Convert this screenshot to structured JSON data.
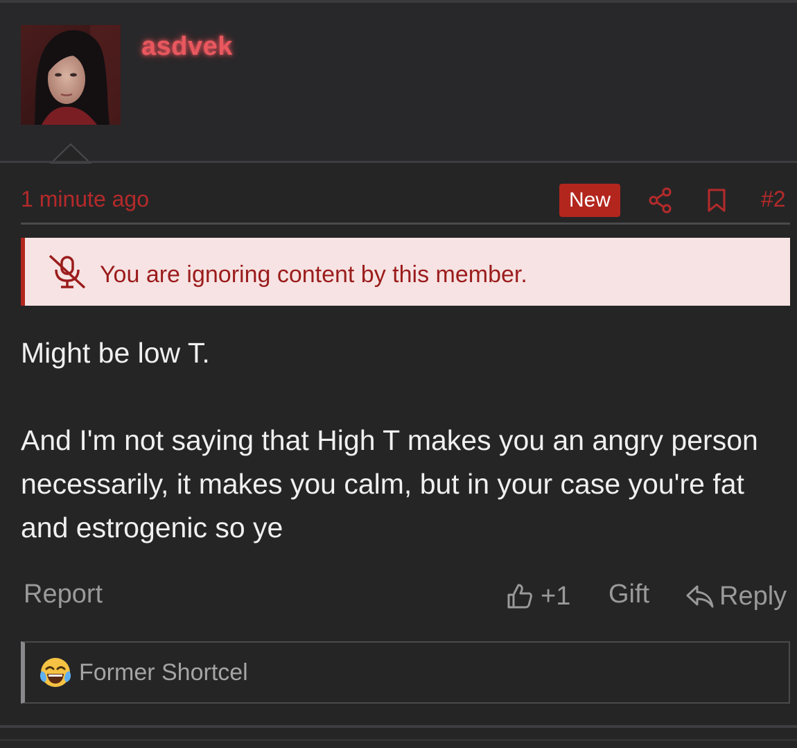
{
  "post": {
    "username": "asdvek",
    "timestamp": "1 minute ago",
    "new_badge": "New",
    "post_number": "#2",
    "icons": {
      "share": "share-icon",
      "bookmark": "bookmark-icon",
      "mute": "mute-microphone-icon",
      "like": "thumbs-up-icon",
      "reply": "reply-arrow-icon",
      "signature_emoji": "crying-laughing-emoji"
    },
    "ignore_notice": "You are ignoring content by this member.",
    "body": {
      "line1": "Might be low T.",
      "para2": "And I'm not saying that High T makes you an angry person necessarily, it makes you calm, but in your case you're fat and estrogenic so ye"
    },
    "actions": {
      "report": "Report",
      "like_count": "+1",
      "gift": "Gift",
      "reply": "Reply"
    },
    "signature": "Former Shortcel"
  },
  "colors": {
    "accent_red": "#b3261e",
    "username_glow": "#e8585e",
    "notice_bg": "#f7e3e3",
    "page_bg": "#252526"
  }
}
